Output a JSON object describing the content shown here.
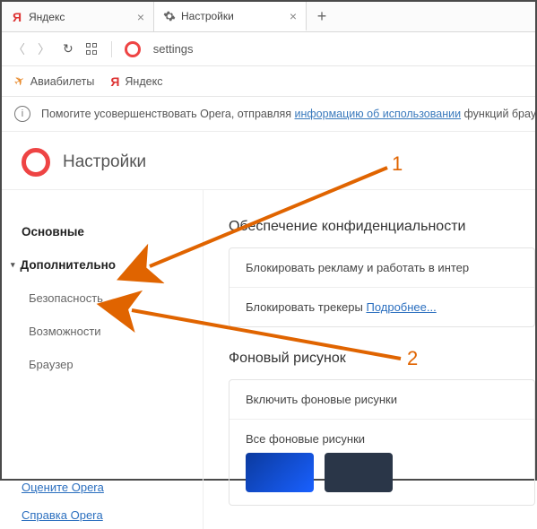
{
  "tabs": [
    {
      "title": "Яндекс",
      "fav": "Я"
    },
    {
      "title": "Настройки",
      "fav": "gear"
    }
  ],
  "url": "settings",
  "bookmarks": [
    {
      "label": "Авиабилеты",
      "icon": "plane"
    },
    {
      "label": "Яндекс",
      "icon": "Я"
    }
  ],
  "banner": {
    "prefix": "Помогите усовершенствовать Opera, отправляя ",
    "link": "информацию об использовании",
    "suffix": " функций браузе"
  },
  "page_title": "Настройки",
  "sidebar": {
    "basic": "Основные",
    "advanced": "Дополнительно",
    "security": "Безопасность",
    "features": "Возможности",
    "browser": "Браузер",
    "rate": "Оцените Opera",
    "help": "Справка Opera"
  },
  "privacy": {
    "title": "Обеспечение конфиденциальности",
    "row1": "Блокировать рекламу и работать в интер",
    "row2_text": "Блокировать трекеры ",
    "row2_link": "Подробнее..."
  },
  "wallpaper": {
    "title": "Фоновый рисунок",
    "row1": "Включить фоновые рисунки",
    "row2": "Все фоновые рисунки"
  },
  "annot": {
    "n1": "1",
    "n2": "2"
  }
}
